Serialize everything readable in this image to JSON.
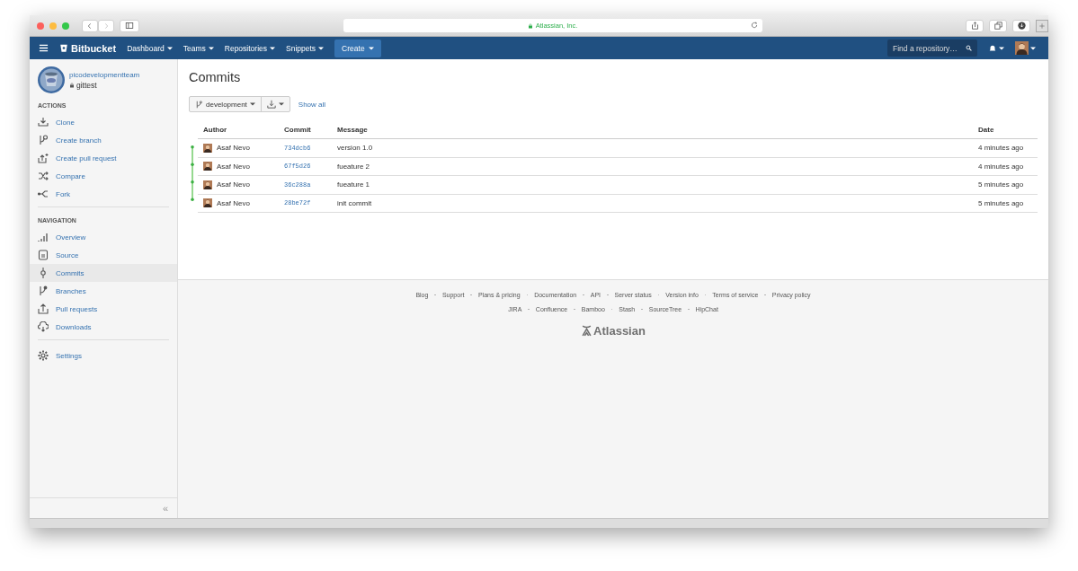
{
  "browser": {
    "address": "Atlassian, Inc."
  },
  "navbar": {
    "logo": "Bitbucket",
    "menus": [
      {
        "label": "Dashboard"
      },
      {
        "label": "Teams"
      },
      {
        "label": "Repositories"
      },
      {
        "label": "Snippets"
      }
    ],
    "create_button": "Create",
    "search": {
      "placeholder": "Find a repository…"
    }
  },
  "sidebar": {
    "team": "picodevelopmentteam",
    "repository": "gittest",
    "sections": [
      {
        "title": "ACTIONS",
        "items": [
          {
            "label": "Clone",
            "selected": false
          },
          {
            "label": "Create branch",
            "selected": false
          },
          {
            "label": "Create pull request",
            "selected": false
          },
          {
            "label": "Compare",
            "selected": false
          },
          {
            "label": "Fork",
            "selected": false
          }
        ]
      },
      {
        "title": "NAVIGATION",
        "items": [
          {
            "label": "Overview",
            "selected": false
          },
          {
            "label": "Source",
            "selected": false
          },
          {
            "label": "Commits",
            "selected": true
          },
          {
            "label": "Branches",
            "selected": false
          },
          {
            "label": "Pull requests",
            "selected": false
          },
          {
            "label": "Downloads",
            "selected": false
          }
        ]
      },
      {
        "items": [
          {
            "label": "Settings",
            "selected": false
          }
        ]
      }
    ],
    "collapse": "«"
  },
  "page": {
    "title": "Commits",
    "branch": "development",
    "show_all": "Show all",
    "columns": [
      "Author",
      "Commit",
      "Message",
      "Date"
    ],
    "commits": [
      {
        "author": "Asaf Nevo",
        "hash": "734dcb6",
        "message": "version 1.0",
        "date": "4 minutes ago"
      },
      {
        "author": "Asaf Nevo",
        "hash": "67f5d26",
        "message": "fueature 2",
        "date": "4 minutes ago"
      },
      {
        "author": "Asaf Nevo",
        "hash": "36c288a",
        "message": "fueature 1",
        "date": "5 minutes ago"
      },
      {
        "author": "Asaf Nevo",
        "hash": "28be72f",
        "message": "init commit",
        "date": "5 minutes ago"
      }
    ]
  },
  "footer": {
    "links": [
      "Blog",
      "Support",
      "Plans & pricing",
      "Documentation",
      "API",
      "Server status",
      "Version info",
      "Terms of service",
      "Privacy policy"
    ],
    "products": [
      "JIRA",
      "Confluence",
      "Bamboo",
      "Stash",
      "SourceTree",
      "HipChat"
    ],
    "logo": "Atlassian"
  }
}
